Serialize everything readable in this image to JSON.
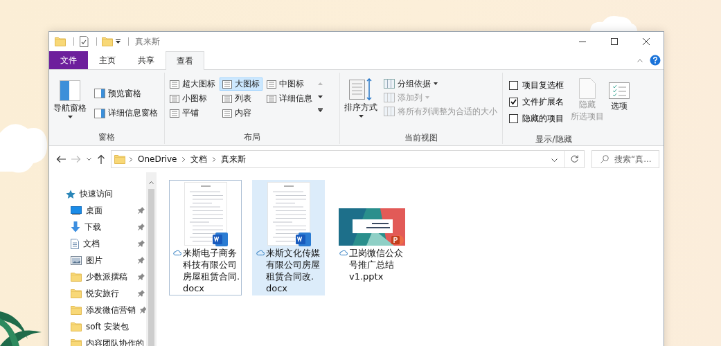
{
  "window": {
    "title": "真来斯"
  },
  "ribbon_tabs": [
    {
      "label": "文件",
      "kind": "file",
      "selected": false
    },
    {
      "label": "主页",
      "kind": "tab",
      "selected": false
    },
    {
      "label": "共享",
      "kind": "tab",
      "selected": false
    },
    {
      "label": "查看",
      "kind": "tab",
      "selected": true
    }
  ],
  "ribbon_groups": [
    {
      "kind": "panes",
      "label": "窗格",
      "large": {
        "label": "导航窗格",
        "dropdown": true
      },
      "items": [
        {
          "label": "预览窗格"
        },
        {
          "label": "详细信息窗格"
        }
      ]
    },
    {
      "kind": "layout",
      "label": "布局",
      "options": [
        {
          "label": "超大图标",
          "selected": false
        },
        {
          "label": "大图标",
          "selected": true
        },
        {
          "label": "中图标",
          "selected": false
        },
        {
          "label": "小图标",
          "selected": false
        },
        {
          "label": "列表",
          "selected": false
        },
        {
          "label": "详细信息",
          "selected": false
        },
        {
          "label": "平铺",
          "selected": false
        },
        {
          "label": "内容",
          "selected": false
        }
      ]
    },
    {
      "kind": "current_view",
      "label": "当前视图",
      "sort": {
        "label": "排序方式",
        "dropdown": true
      },
      "items": [
        {
          "label": "分组依据",
          "dropdown": true,
          "disabled": false
        },
        {
          "label": "添加列",
          "dropdown": true,
          "disabled": true
        },
        {
          "label": "将所有列调整为合适的大小",
          "dropdown": false,
          "disabled": true
        }
      ]
    },
    {
      "kind": "show_hide",
      "label": "显示/隐藏",
      "checkboxes": [
        {
          "label": "项目复选框",
          "checked": false
        },
        {
          "label": "文件扩展名",
          "checked": true
        },
        {
          "label": "隐藏的项目",
          "checked": false
        }
      ],
      "hide_button": {
        "lines": [
          "隐藏",
          "所选项目"
        ],
        "disabled": true
      }
    },
    {
      "kind": "options",
      "button": {
        "label": "选项"
      }
    }
  ],
  "address_bar": {
    "path": [
      "OneDrive",
      "文档",
      "真来斯"
    ],
    "search_placeholder": "搜索“真..."
  },
  "nav_pane": {
    "items": [
      {
        "label": "快速访问",
        "kind": "quick_access",
        "children": [
          {
            "label": "桌面",
            "kind": "desktop",
            "pinned": true
          },
          {
            "label": "下载",
            "kind": "downloads",
            "pinned": true
          },
          {
            "label": "文档",
            "kind": "documents",
            "pinned": true
          },
          {
            "label": "图片",
            "kind": "pictures",
            "pinned": true
          },
          {
            "label": "少数派撰稿",
            "kind": "folder",
            "pinned": true
          },
          {
            "label": "悦安旅行",
            "kind": "folder",
            "pinned": true
          },
          {
            "label": "添发微信营销",
            "kind": "folder",
            "pinned": true
          },
          {
            "label": "soft 安装包",
            "kind": "folder",
            "pinned": false
          },
          {
            "label": "内容团队协作的",
            "kind": "folder"
          }
        ]
      }
    ]
  },
  "files": [
    {
      "name": "来斯电子商务科技有限公司房屋租赁合同.docx",
      "kind": "docx",
      "selected": false,
      "focused": true
    },
    {
      "name": "来斯文化传媒有限公司房屋租赁合同改.docx",
      "kind": "docx",
      "selected": true,
      "focused": false
    },
    {
      "name": "卫岗微信公众号推广总结v1.pptx",
      "kind": "pptx",
      "selected": false,
      "focused": false
    }
  ]
}
